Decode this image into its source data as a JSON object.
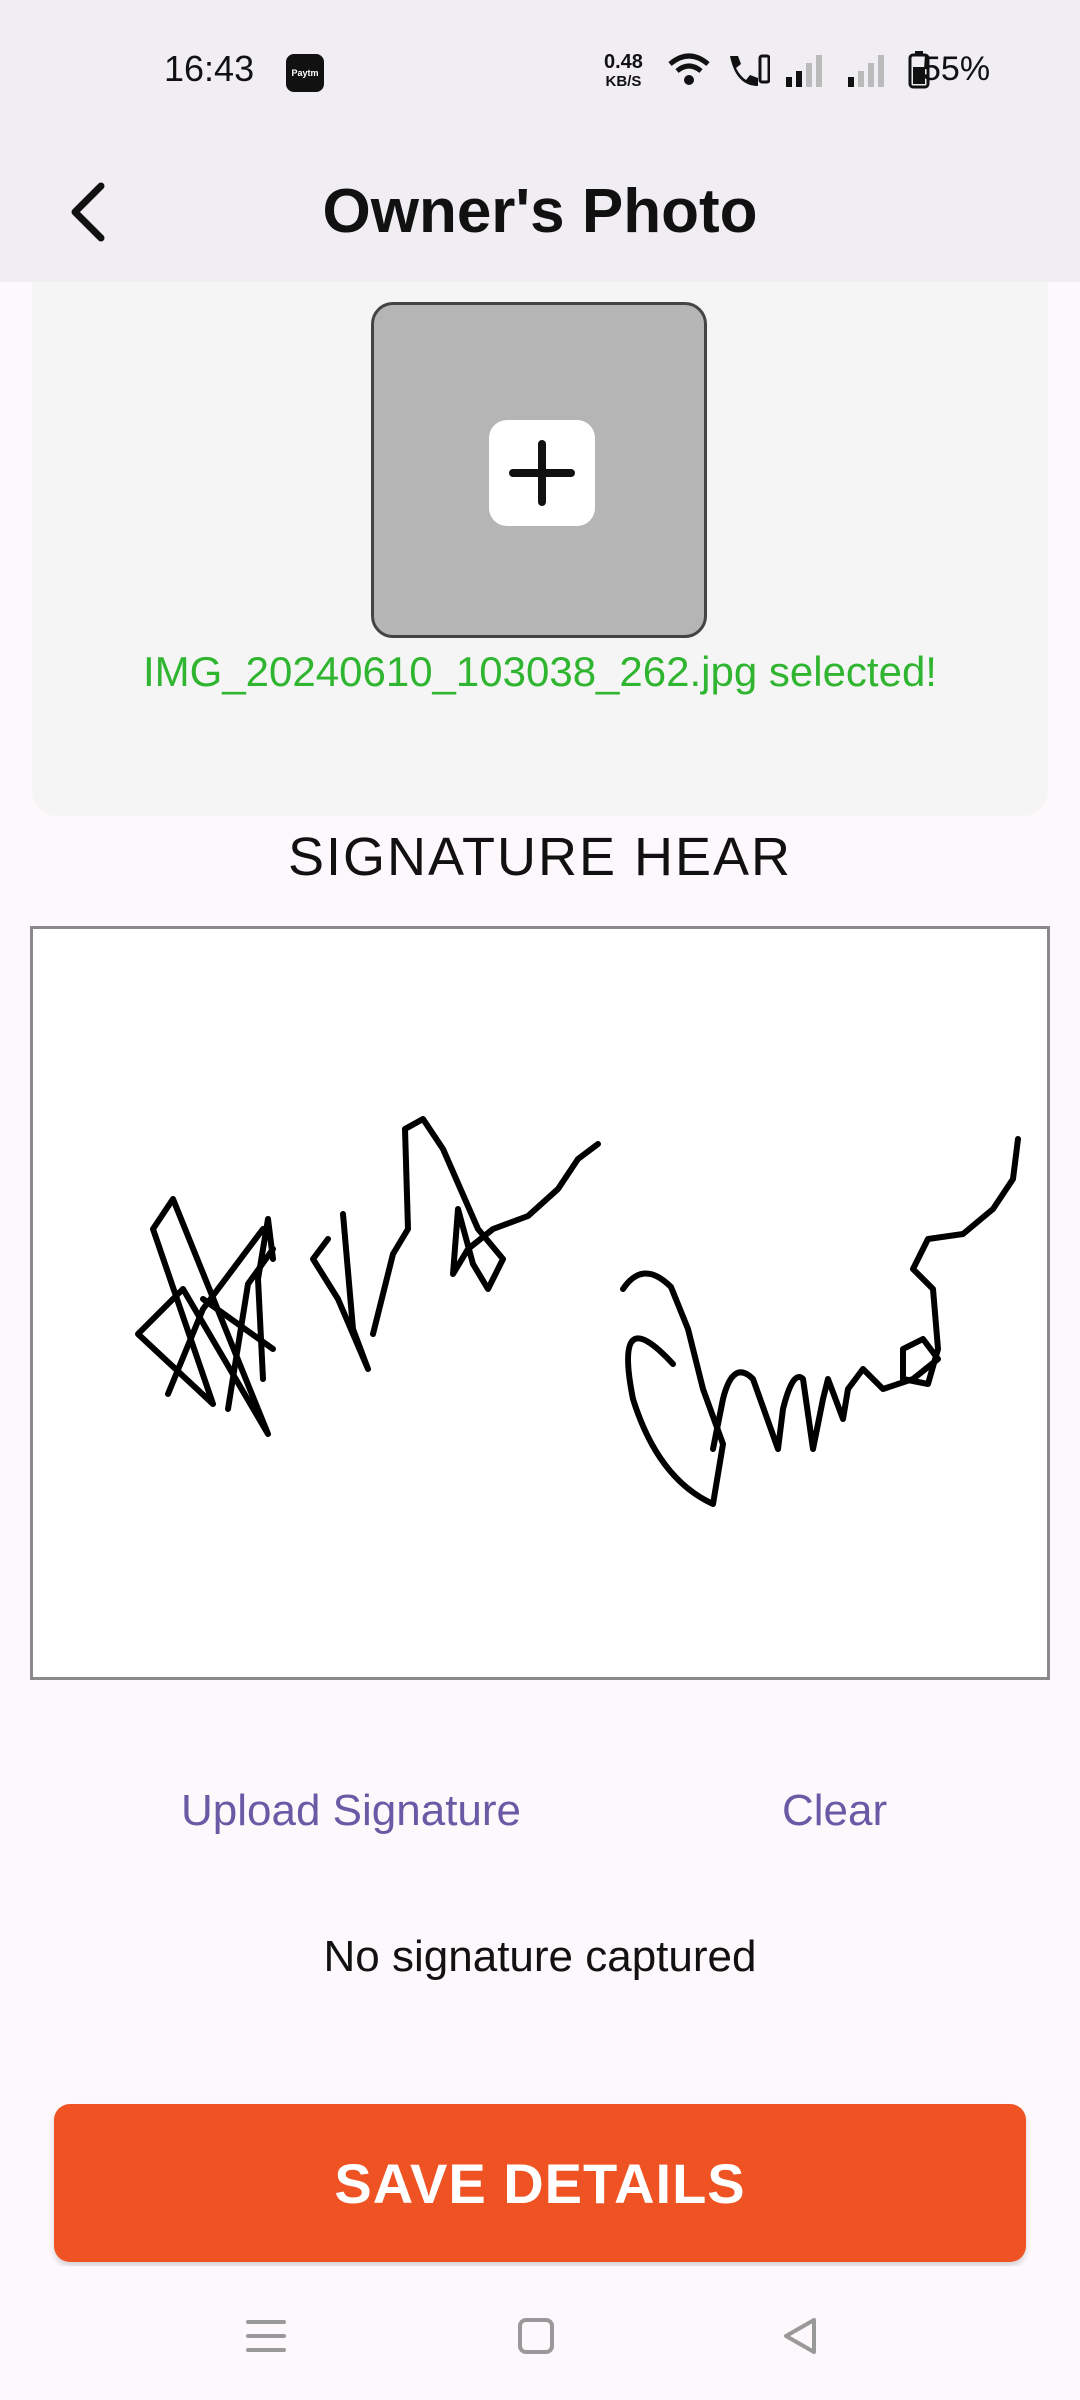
{
  "status_bar": {
    "time": "16:43",
    "app_badge": "Paytm",
    "net_speed_value": "0.48",
    "net_speed_unit": "KB/S",
    "battery_percent": "55%",
    "icons": [
      "wifi-icon",
      "call-icon",
      "signal-icon",
      "signal-icon",
      "battery-icon"
    ]
  },
  "header": {
    "title": "Owner's Photo",
    "back_icon": "chevron-left-icon"
  },
  "photo": {
    "add_icon": "plus-icon",
    "selected_text": "IMG_20240610_103038_262.jpg selected!"
  },
  "signature": {
    "label": "SIGNATURE HEAR",
    "upload_label": "Upload Signature",
    "clear_label": "Clear",
    "status_text": "No signature captured"
  },
  "footer": {
    "save_label": "SAVE DETAILS"
  },
  "nav": {
    "icons": [
      "menu-icon",
      "home-icon",
      "back-icon"
    ]
  },
  "colors": {
    "accent": "#f05323",
    "success_text": "#2fb52f",
    "link": "#6a5aa6"
  }
}
